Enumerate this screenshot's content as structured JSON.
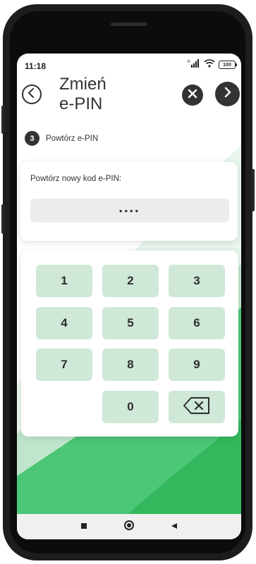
{
  "status_bar": {
    "time": "11:18",
    "battery": "100",
    "signal_icon": "signal-icon",
    "wifi_icon": "wifi-icon"
  },
  "header": {
    "title_line1": "Zmień",
    "title_line2": "e-PIN",
    "back_icon": "chevron-left-icon",
    "close_icon": "close-icon",
    "next_icon": "chevron-right-icon"
  },
  "step": {
    "number": "3",
    "label": "Powtórz e-PIN"
  },
  "pin_card": {
    "label": "Powtórz nowy kod e-PIN:",
    "value": "••••"
  },
  "keypad": {
    "keys": [
      "1",
      "2",
      "3",
      "4",
      "5",
      "6",
      "7",
      "8",
      "9",
      "0"
    ],
    "backspace_icon": "backspace-icon"
  },
  "nav_bar": {
    "recents_icon": "square-icon",
    "home_icon": "circle-icon",
    "back_icon": "triangle-back-icon"
  },
  "colors": {
    "accent_green": "#3cc26a",
    "key_bg": "#cfe8d8",
    "dark": "#333333"
  }
}
